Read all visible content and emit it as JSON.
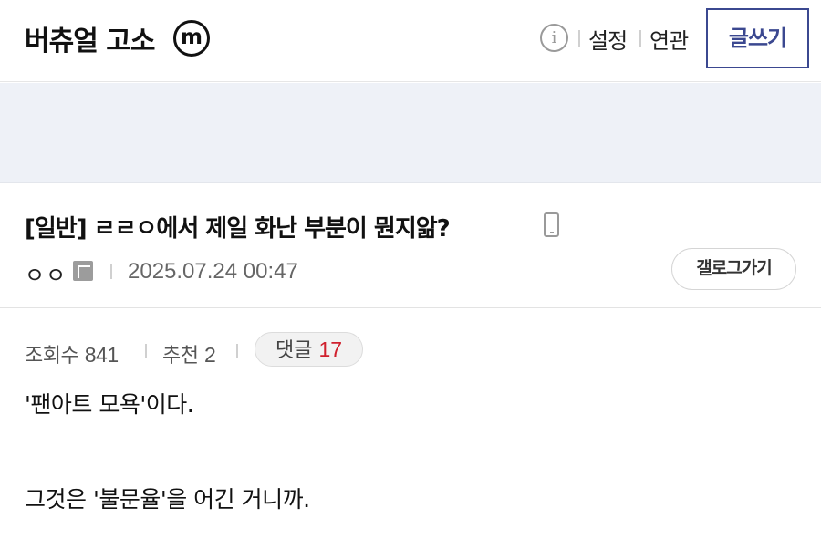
{
  "header": {
    "gallery_title": "버츄얼 고소",
    "minor_badge": "m",
    "info_icon": "info-icon",
    "settings_label": "설정",
    "related_label": "연관",
    "write_label": "글쓰기"
  },
  "post": {
    "title": "[일반] ㄹㄹㅇ에서 제일 화난 부분이 뭔지앎?",
    "device_icon": "mobile-phone-icon",
    "author": "ㅇㅇ",
    "author_icon": "fixed-nick-icon",
    "date": "2025.07.24 00:47",
    "gallery_button": "갤로그가기",
    "views_label": "조회수",
    "views": "841",
    "recommend_label": "추천",
    "recommends": "2",
    "comments_label": "댓글",
    "comments": "17",
    "body": [
      "'팬아트 모욕'이다.",
      "",
      "그것은 '불문율'을 어긴 거니까."
    ]
  },
  "colors": {
    "accent": "#3b4890",
    "banner_bg": "#eef1f7",
    "comment_count": "#d0202d"
  }
}
